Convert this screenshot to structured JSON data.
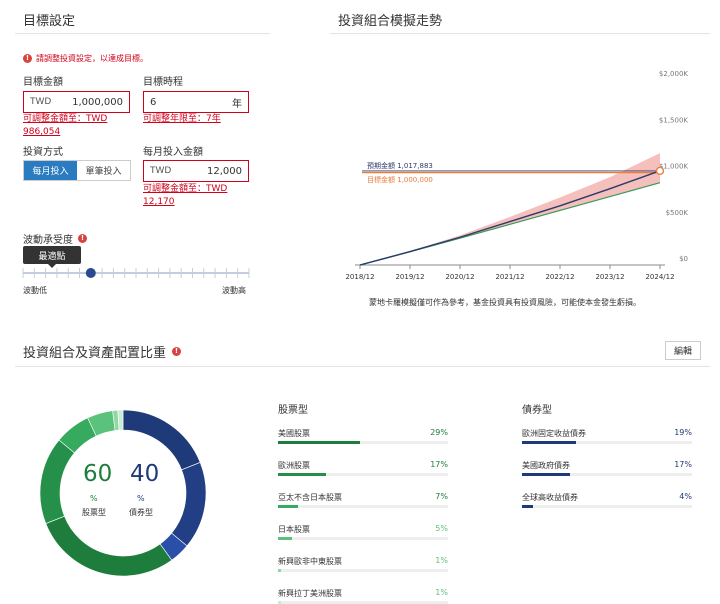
{
  "goal": {
    "title": "目標設定",
    "warning": "請調整投資設定，以達成目標。",
    "amount": {
      "label": "目標金額",
      "currency": "TWD",
      "value": "1,000,000",
      "hint": "可調整金額至：TWD 986,054"
    },
    "period": {
      "label": "目標時程",
      "value": "6",
      "unit": "年",
      "hint": "可調整年限至：7年"
    },
    "method": {
      "label": "投資方式",
      "options": [
        "每月投入",
        "單筆投入"
      ],
      "selected": "每月投入"
    },
    "monthly": {
      "label": "每月投入金額",
      "currency": "TWD",
      "value": "12,000",
      "hint": "可調整金額至：TWD 12,170"
    },
    "risk": {
      "label": "波動承受度",
      "tooltip": "最適點",
      "min_label": "波動低",
      "max_label": "波動高",
      "level": 0.3
    }
  },
  "simulation": {
    "title": "投資組合模擬走勢",
    "note": "蒙地卡羅模擬僅可作為參考，基金投資具有投資風險，可能使本金發生虧損。",
    "legend_expected": "預期金額 1,017,883",
    "legend_target": "目標金額 1,000,000",
    "colors": {
      "expected": "#2b3a6b",
      "target": "#e87d3e",
      "band": "#f3b4b0",
      "lower": "#3a9a5b"
    }
  },
  "chart_data": {
    "type": "line",
    "x": [
      "2018/12",
      "2019/12",
      "2020/12",
      "2021/12",
      "2022/12",
      "2023/12",
      "2024/12"
    ],
    "y_ticks": [
      "$0",
      "$500K",
      "$1,000K",
      "$1,500K",
      "$2,000K"
    ],
    "ylim": [
      0,
      2000000
    ],
    "series": [
      {
        "name": "預期金額",
        "values": [
          0,
          145000,
          300000,
          470000,
          640000,
          825000,
          1017883
        ]
      },
      {
        "name": "目標金額",
        "values": [
          1000000,
          1000000,
          1000000,
          1000000,
          1000000,
          1000000,
          1000000
        ]
      }
    ],
    "band_upper": [
      0,
      150000,
      320000,
      520000,
      730000,
      950000,
      1210000
    ],
    "band_lower": [
      0,
      143000,
      290000,
      440000,
      590000,
      740000,
      890000
    ]
  },
  "allocation": {
    "title": "投資組合及資產配置比重",
    "edit_label": "編輯",
    "donut": {
      "stock_pct": "60",
      "bond_pct": "40",
      "pct_sign": "%",
      "stock_label": "股票型",
      "bond_label": "債券型",
      "segments": [
        {
          "value": 19,
          "color": "#1f3a78"
        },
        {
          "value": 17,
          "color": "#223f85"
        },
        {
          "value": 4,
          "color": "#2a4fa8"
        },
        {
          "value": 29,
          "color": "#1e7d3c"
        },
        {
          "value": 17,
          "color": "#24904a"
        },
        {
          "value": 7,
          "color": "#36aa5e"
        },
        {
          "value": 5,
          "color": "#5bc27c"
        },
        {
          "value": 1,
          "color": "#8fd8a4"
        },
        {
          "value": 1,
          "color": "#c9edd3"
        }
      ]
    },
    "stock_group": {
      "title": "股票型",
      "items": [
        {
          "name": "美國股票",
          "pct": "29%",
          "value": 29
        },
        {
          "name": "歐洲股票",
          "pct": "17%",
          "value": 17
        },
        {
          "name": "亞太不含日本股票",
          "pct": "7%",
          "value": 7
        },
        {
          "name": "日本股票",
          "pct": "5%",
          "value": 5
        },
        {
          "name": "新興歐非中東股票",
          "pct": "1%",
          "value": 1
        },
        {
          "name": "新興拉丁美洲股票",
          "pct": "1%",
          "value": 1
        }
      ]
    },
    "bond_group": {
      "title": "債券型",
      "items": [
        {
          "name": "歐洲固定收益債券",
          "pct": "19%",
          "value": 19
        },
        {
          "name": "美國政府債券",
          "pct": "17%",
          "value": 17
        },
        {
          "name": "全球高收益債券",
          "pct": "4%",
          "value": 4
        }
      ]
    }
  }
}
